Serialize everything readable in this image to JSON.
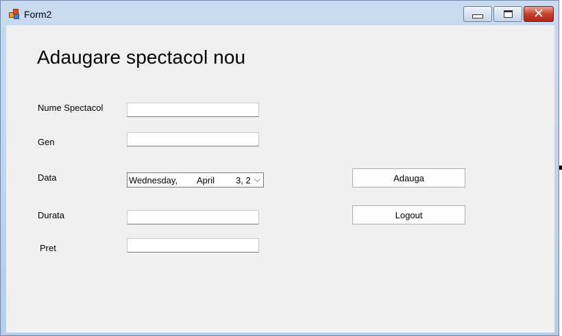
{
  "window": {
    "title": "Form2",
    "icon": "app-form-icon"
  },
  "controls": {
    "minimize": "minimize-icon",
    "maximize": "maximize-icon",
    "close": "close-icon"
  },
  "form": {
    "heading": "Adaugare spectacol nou",
    "fields": {
      "nume_spectacol": {
        "label": "Nume Spectacol",
        "value": ""
      },
      "gen": {
        "label": "Gen",
        "value": ""
      },
      "data": {
        "label": "Data",
        "weekday": "Wednesday,",
        "month": "April",
        "day": "3, 2"
      },
      "durata": {
        "label": "Durata",
        "value": ""
      },
      "pret": {
        "label": "Pret",
        "value": ""
      }
    },
    "buttons": {
      "add": "Adauga",
      "logout": "Logout"
    }
  }
}
